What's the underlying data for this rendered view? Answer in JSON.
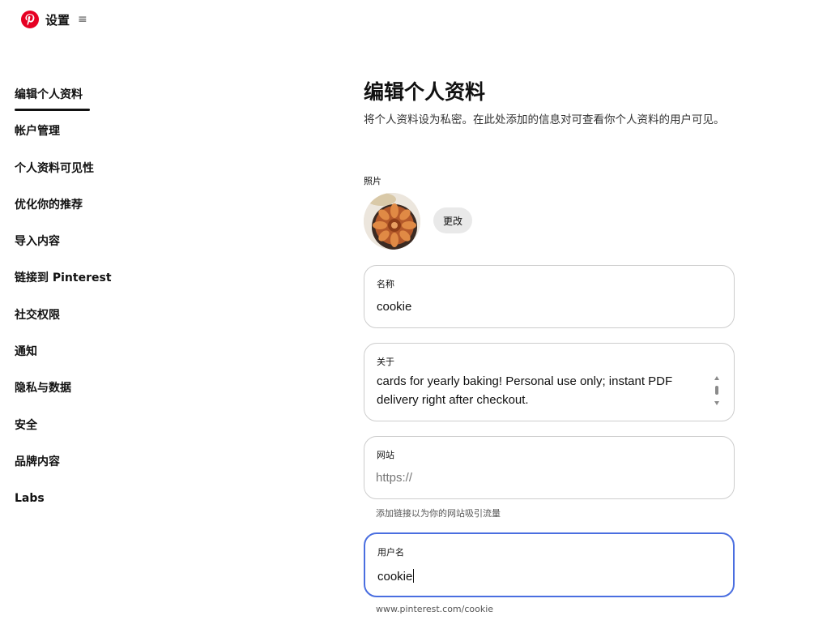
{
  "header": {
    "title": "设置",
    "menu_icon": "hamburger-icon",
    "logo": "pinterest-logo-icon",
    "brand_color": "#e60023"
  },
  "sidebar": {
    "items": [
      {
        "label": "编辑个人资料",
        "active": true
      },
      {
        "label": "帐户管理"
      },
      {
        "label": "个人资料可见性"
      },
      {
        "label": "优化你的推荐"
      },
      {
        "label": "导入内容"
      },
      {
        "label": "链接到 Pinterest"
      },
      {
        "label": "社交权限"
      },
      {
        "label": "通知"
      },
      {
        "label": "隐私与数据"
      },
      {
        "label": "安全"
      },
      {
        "label": "品牌内容"
      },
      {
        "label": "Labs"
      }
    ]
  },
  "main": {
    "title": "编辑个人资料",
    "description": "将个人资料设为私密。在此处添加的信息对可查看你个人资料的用户可见。",
    "photo": {
      "label": "照片",
      "change_label": "更改"
    },
    "name": {
      "label": "名称",
      "value": "cookie"
    },
    "about": {
      "label": "关于",
      "value": "cards for yearly baking! Personal use only; instant PDF delivery right after checkout."
    },
    "website": {
      "label": "网站",
      "placeholder": "https://",
      "helper": "添加链接以为你的网站吸引流量"
    },
    "username": {
      "label": "用户名",
      "value": "cookie",
      "helper": "www.pinterest.com/cookie",
      "focus_color": "#4a6ee0"
    }
  }
}
